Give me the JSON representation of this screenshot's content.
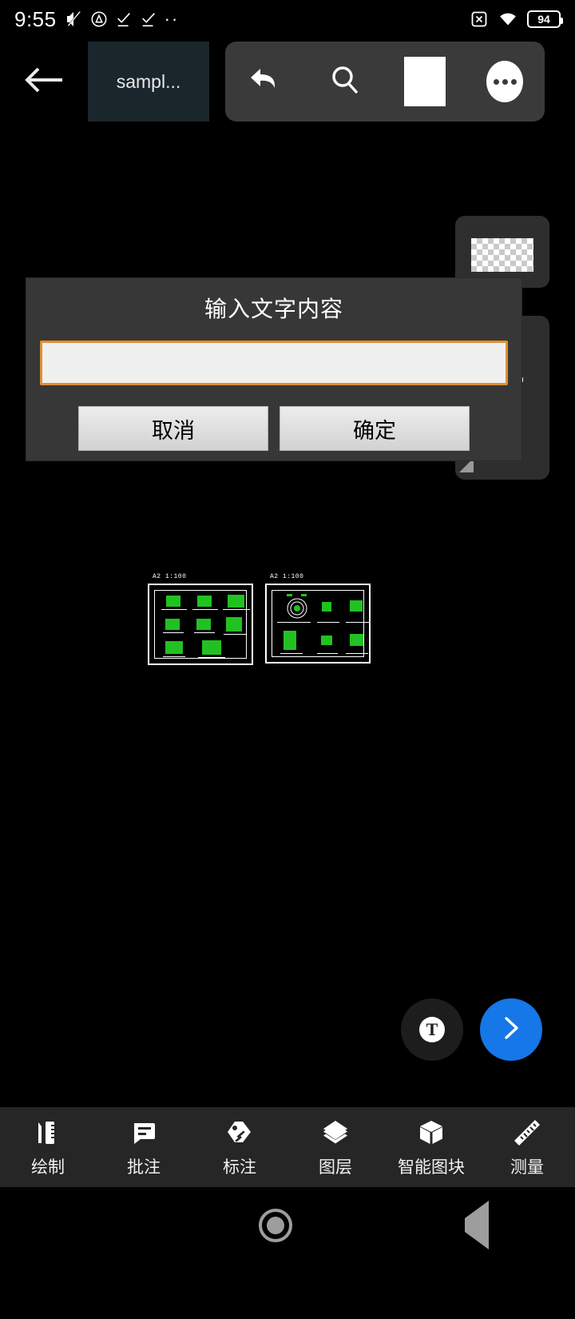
{
  "status_bar": {
    "time": "9:55",
    "battery_level": "94",
    "icons_left": [
      "mute-icon",
      "triangle-drive-icon",
      "check-task-icon",
      "check-task-icon",
      "more-dots-icon"
    ],
    "icons_right": [
      "sim-disabled-icon",
      "wifi-icon",
      "battery-icon"
    ]
  },
  "top_bar": {
    "back_icon": "back-arrow-icon",
    "tab_label": "sampl...",
    "tools": [
      {
        "name": "undo-icon",
        "label": "Undo"
      },
      {
        "name": "search-icon",
        "label": "Search"
      },
      {
        "name": "white-square-icon",
        "label": "Canvas"
      },
      {
        "name": "more-icon",
        "label": "More"
      }
    ]
  },
  "dialog": {
    "title": "输入文字内容",
    "input_value": "",
    "input_placeholder": "",
    "cancel_label": "取消",
    "confirm_label": "确定",
    "accent_color": "#e08f33",
    "background_color": "#373737"
  },
  "side_panel": {
    "swatch": "transparent-checker-swatch",
    "line_widths": [
      "thin",
      "thick",
      "thin",
      "thin"
    ],
    "resize_handle": "resize-handle-icon"
  },
  "canvas": {
    "sheets": [
      {
        "label": "A2 1:100"
      },
      {
        "label": "A2 1:100"
      }
    ],
    "drawing_color": "#22c122"
  },
  "fabs": [
    {
      "name": "text-tool-fab",
      "glyph": "T",
      "color": "#1d1d1d"
    },
    {
      "name": "next-fab",
      "glyph": "›",
      "color": "#1577e8"
    }
  ],
  "bottom_nav": {
    "items": [
      {
        "label": "绘制",
        "icon": "pencil-ruler-icon"
      },
      {
        "label": "批注",
        "icon": "comment-icon"
      },
      {
        "label": "标注",
        "icon": "tag-icon"
      },
      {
        "label": "图层",
        "icon": "layers-icon"
      },
      {
        "label": "智能图块",
        "icon": "block-3d-icon"
      },
      {
        "label": "测量",
        "icon": "measure-ruler-icon"
      }
    ]
  },
  "system_nav": {
    "recent": "recents-square-icon",
    "home": "home-circle-icon",
    "back": "back-triangle-icon"
  }
}
